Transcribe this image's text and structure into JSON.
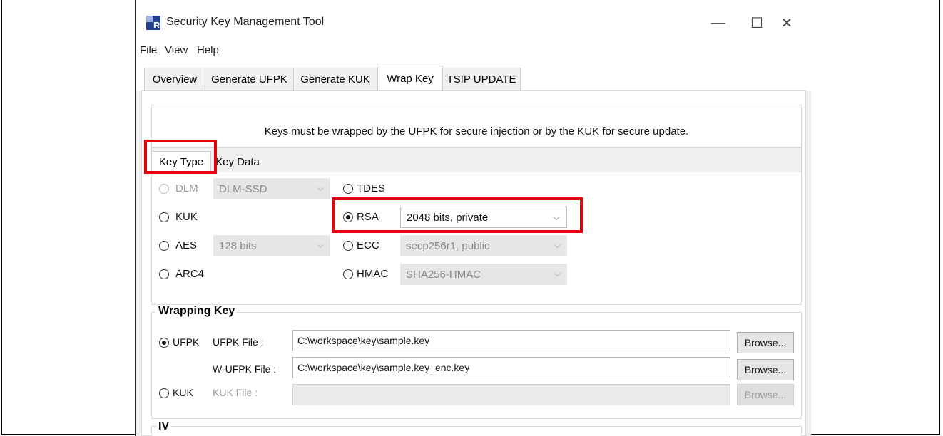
{
  "window": {
    "title": "Security Key Management Tool",
    "controls": {
      "minimize": "—",
      "maximize": "☐",
      "close": "✕"
    }
  },
  "menu": {
    "file": "File",
    "view": "View",
    "help": "Help"
  },
  "tabs": [
    {
      "label": "Overview"
    },
    {
      "label": "Generate UFPK"
    },
    {
      "label": "Generate KUK"
    },
    {
      "label": "Wrap Key"
    },
    {
      "label": "TSIP UPDATE"
    }
  ],
  "message": "Keys must be wrapped by the UFPK for secure injection or by the KUK for secure update.",
  "key_tabs": {
    "key_type": "Key Type",
    "key_data": "Key Data"
  },
  "key_types": {
    "dlm": {
      "label": "DLM",
      "option": "DLM-SSD"
    },
    "kuk": {
      "label": "KUK"
    },
    "aes": {
      "label": "AES",
      "option": "128 bits"
    },
    "arc4": {
      "label": "ARC4"
    },
    "tdes": {
      "label": "TDES"
    },
    "rsa": {
      "label": "RSA",
      "option": "2048 bits, private"
    },
    "ecc": {
      "label": "ECC",
      "option": "secp256r1, public"
    },
    "hmac": {
      "label": "HMAC",
      "option": "SHA256-HMAC"
    }
  },
  "wrapping_key": {
    "heading": "Wrapping Key",
    "ufpk_radio": "UFPK",
    "ufpk_file_label": "UFPK File :",
    "ufpk_file_value": "C:\\workspace\\key\\sample.key",
    "wufpk_file_label": "W-UFPK File :",
    "wufpk_file_value": "C:\\workspace\\key\\sample.key_enc.key",
    "kuk_radio": "KUK",
    "kuk_file_label": "KUK File :",
    "kuk_file_value": "",
    "browse_label": "Browse..."
  },
  "iv": {
    "heading": "IV"
  },
  "colors": {
    "highlight": "#e8000c"
  }
}
